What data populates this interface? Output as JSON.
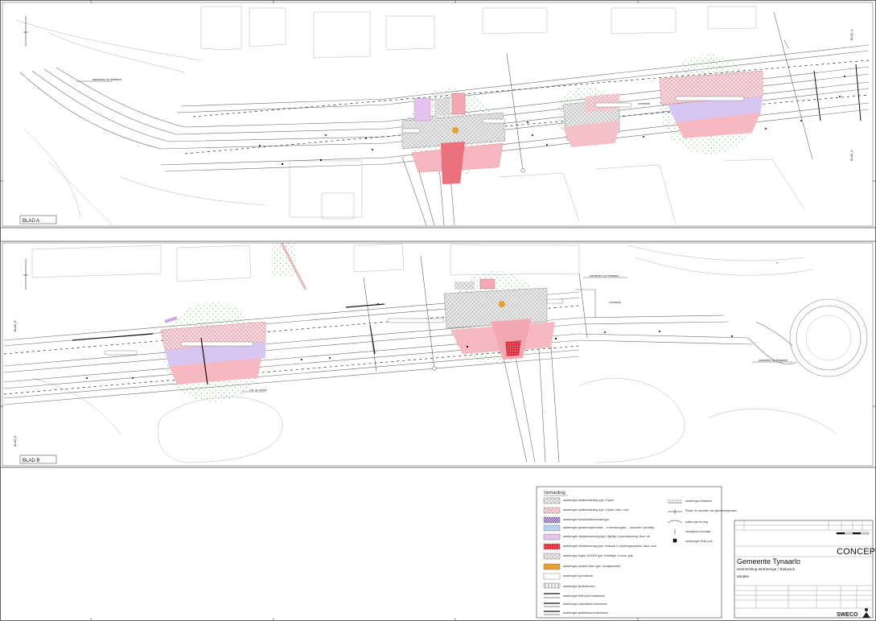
{
  "sheets": [
    {
      "label": "BLAD A"
    },
    {
      "label": "BLAD B"
    }
  ],
  "annotations": {
    "a_left": "aansluiten op bestaand",
    "a_crossing": "oversteek",
    "b_top": "aansluiten op bestaand",
    "b_crossing": "oversteek",
    "b_right": "aansluiten op bestaand",
    "b_mast": "Lat. op. kolser"
  },
  "legend": {
    "title": "Verharding",
    "items": [
      {
        "label": "aanbrengen asfaltverharding type: 4 fijnen"
      },
      {
        "label": "aanbrengen asfaltverharding type: 4 fijnen, kleur: rood"
      },
      {
        "label": "aanbrengen betonklinkerbestraat type:"
      },
      {
        "label": "aanbrengen geleidenoppervlakte ... in streepnoppen ... aanvullen, rijrichting"
      },
      {
        "label": "aanbrengen rijwijzermarkering type: (tijdelijk 4 opvulmarkering, kleur: wit"
      },
      {
        "label": "aanbrengen ribbelmarkering type: Verticaal, in rijrichtingssymbool, kleur: rood"
      },
      {
        "label": "aanbrengen tegels 300x300 type: reliëftegel, in kleur: grijs"
      },
      {
        "label": "aanbrengen gesteld riolen type: noodgeschakel"
      },
      {
        "label": "aanbrengen groenstrook"
      },
      {
        "label": "aanbrengen lijnafscheiden"
      },
      {
        "label": "aanbrengen Roff-band trottoirband"
      },
      {
        "label": "aanbrengen opsluitband trottoirband"
      },
      {
        "label": "aanbrengen geleideband trottoirband"
      }
    ],
    "items_right": [
      {
        "label": "aanbrengen biesband"
      },
      {
        "label": "Plaats- en opmeten van gemeentegrenzen"
      },
      {
        "label": "kolken aan de weg"
      },
      {
        "label": "verwijderen kruimaal"
      },
      {
        "label": "aanbrengen Roff-Lock"
      }
    ]
  },
  "title_block": {
    "stamp": "CONCEPT",
    "client": "Gemeente Tynaarlo",
    "project": "Herinrichting Ieroheenge | Tonbosch",
    "subtitle": "Situatie",
    "company": "SWECO"
  },
  "colors": {
    "pink_hatch": "#f4b8c0",
    "red_fill": "#e8313f",
    "violet": "#c9a8e8",
    "grey_hatch": "#9a9a9a",
    "green_dot": "#5bbb5b",
    "orange": "#e8a030",
    "line": "#6e6e6e"
  }
}
